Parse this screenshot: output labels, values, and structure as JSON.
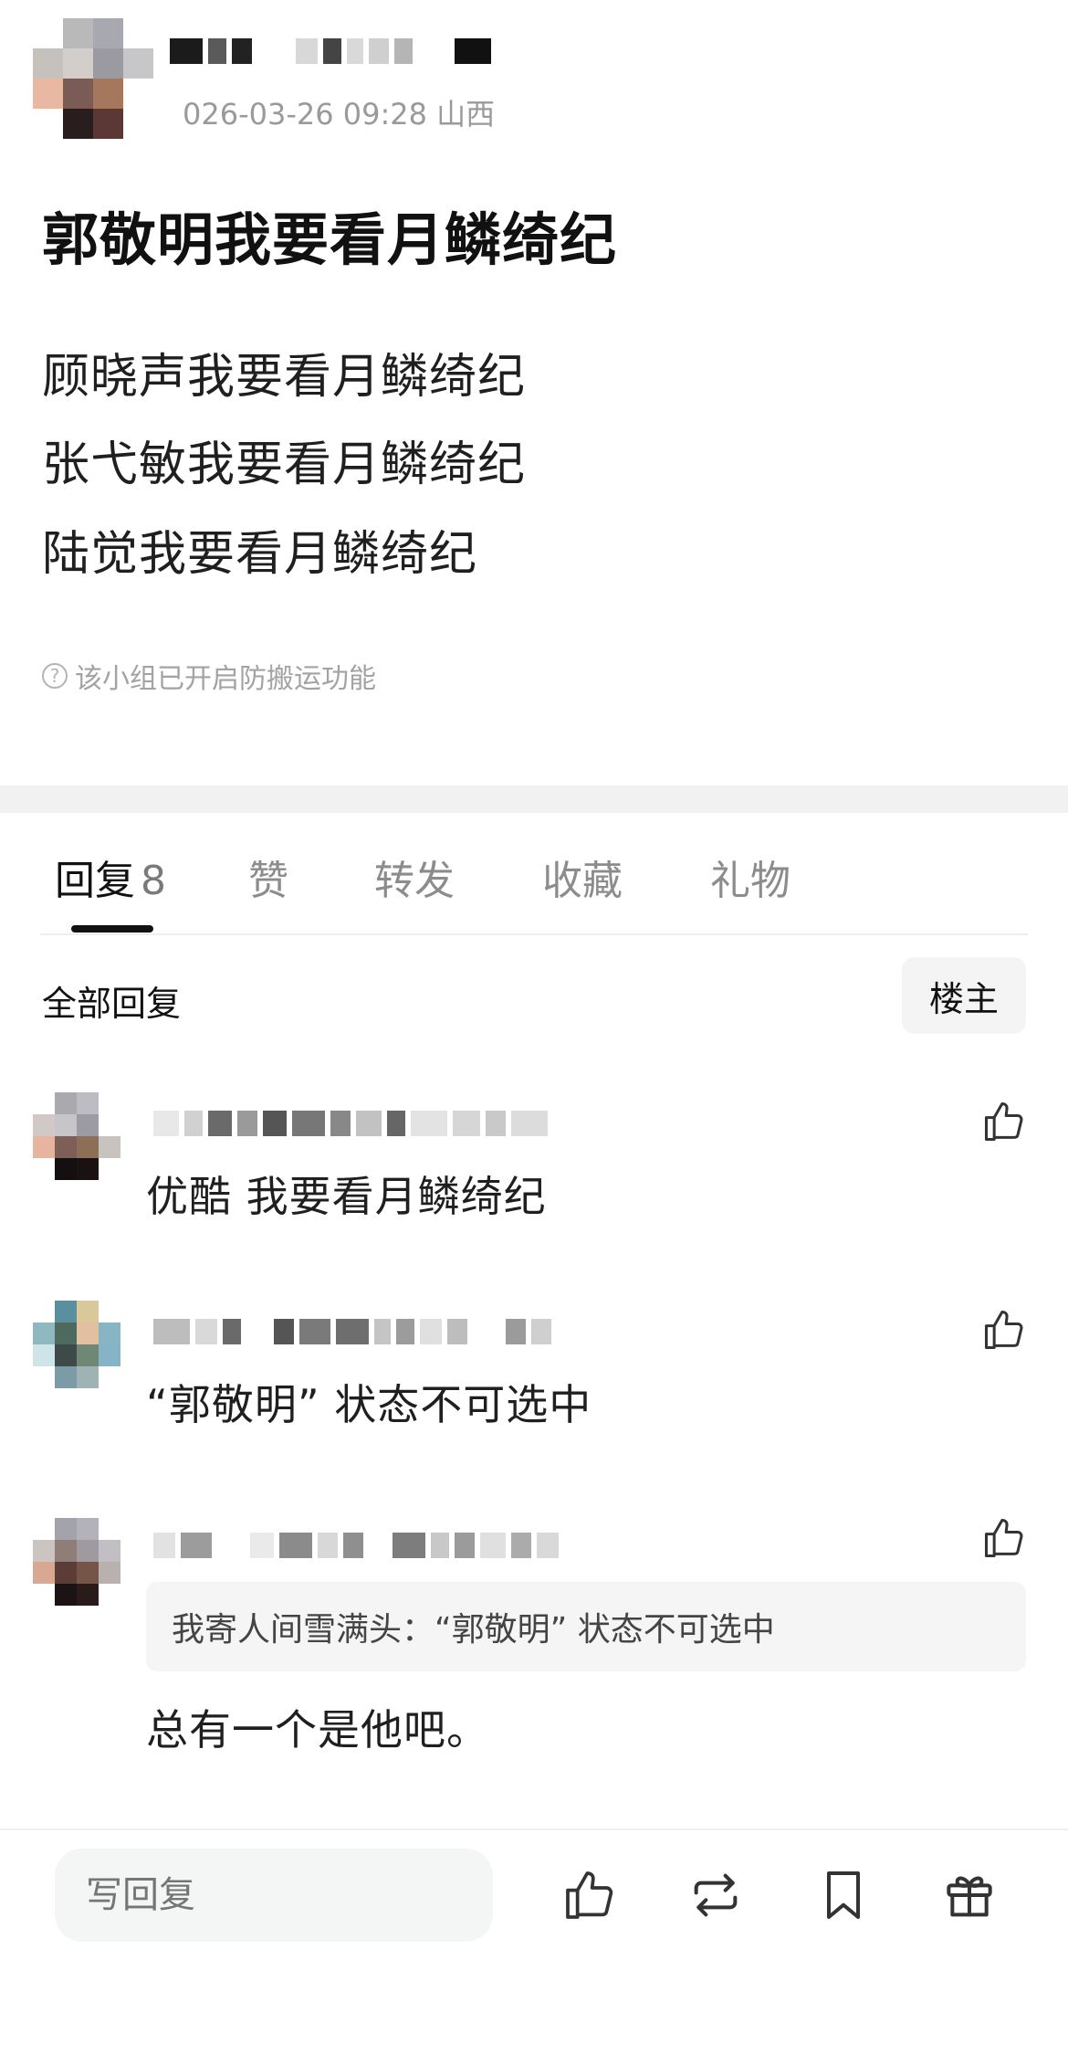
{
  "post": {
    "author_name": "",
    "meta": "026-03-26 09:28  山西",
    "title": "郭敬明我要看月鳞绮纪",
    "lines": [
      "顾晓声我要看月鳞绮纪",
      "张弋敏我要看月鳞绮纪",
      "陆觉我要看月鳞绮纪"
    ],
    "notice": "该小组已开启防搬运功能",
    "notice_icon": "help-circle-icon"
  },
  "tabs": [
    {
      "label": "回复",
      "count": "8",
      "active": true
    },
    {
      "label": "赞"
    },
    {
      "label": "转发"
    },
    {
      "label": "收藏"
    },
    {
      "label": "礼物"
    }
  ],
  "replies_header": {
    "title": "全部回复",
    "filter_button": "楼主"
  },
  "replies": [
    {
      "text": "优酷 我要看月鳞绮纪",
      "like_icon": "thumbs-up-icon"
    },
    {
      "text": "“郭敬明” 状态不可选中",
      "like_icon": "thumbs-up-icon"
    },
    {
      "quote": "我寄人间雪满头：“郭敬明” 状态不可选中",
      "text": "总有一个是他吧。",
      "like_icon": "thumbs-up-icon"
    }
  ],
  "bottom_bar": {
    "placeholder": "写回复",
    "icons": [
      "thumbs-up-icon",
      "repost-icon",
      "bookmark-icon",
      "gift-icon"
    ]
  },
  "colors": {
    "divider": "#f1f1f1",
    "input_bg": "#f3f6f4",
    "muted_text": "#9a9a9a"
  }
}
